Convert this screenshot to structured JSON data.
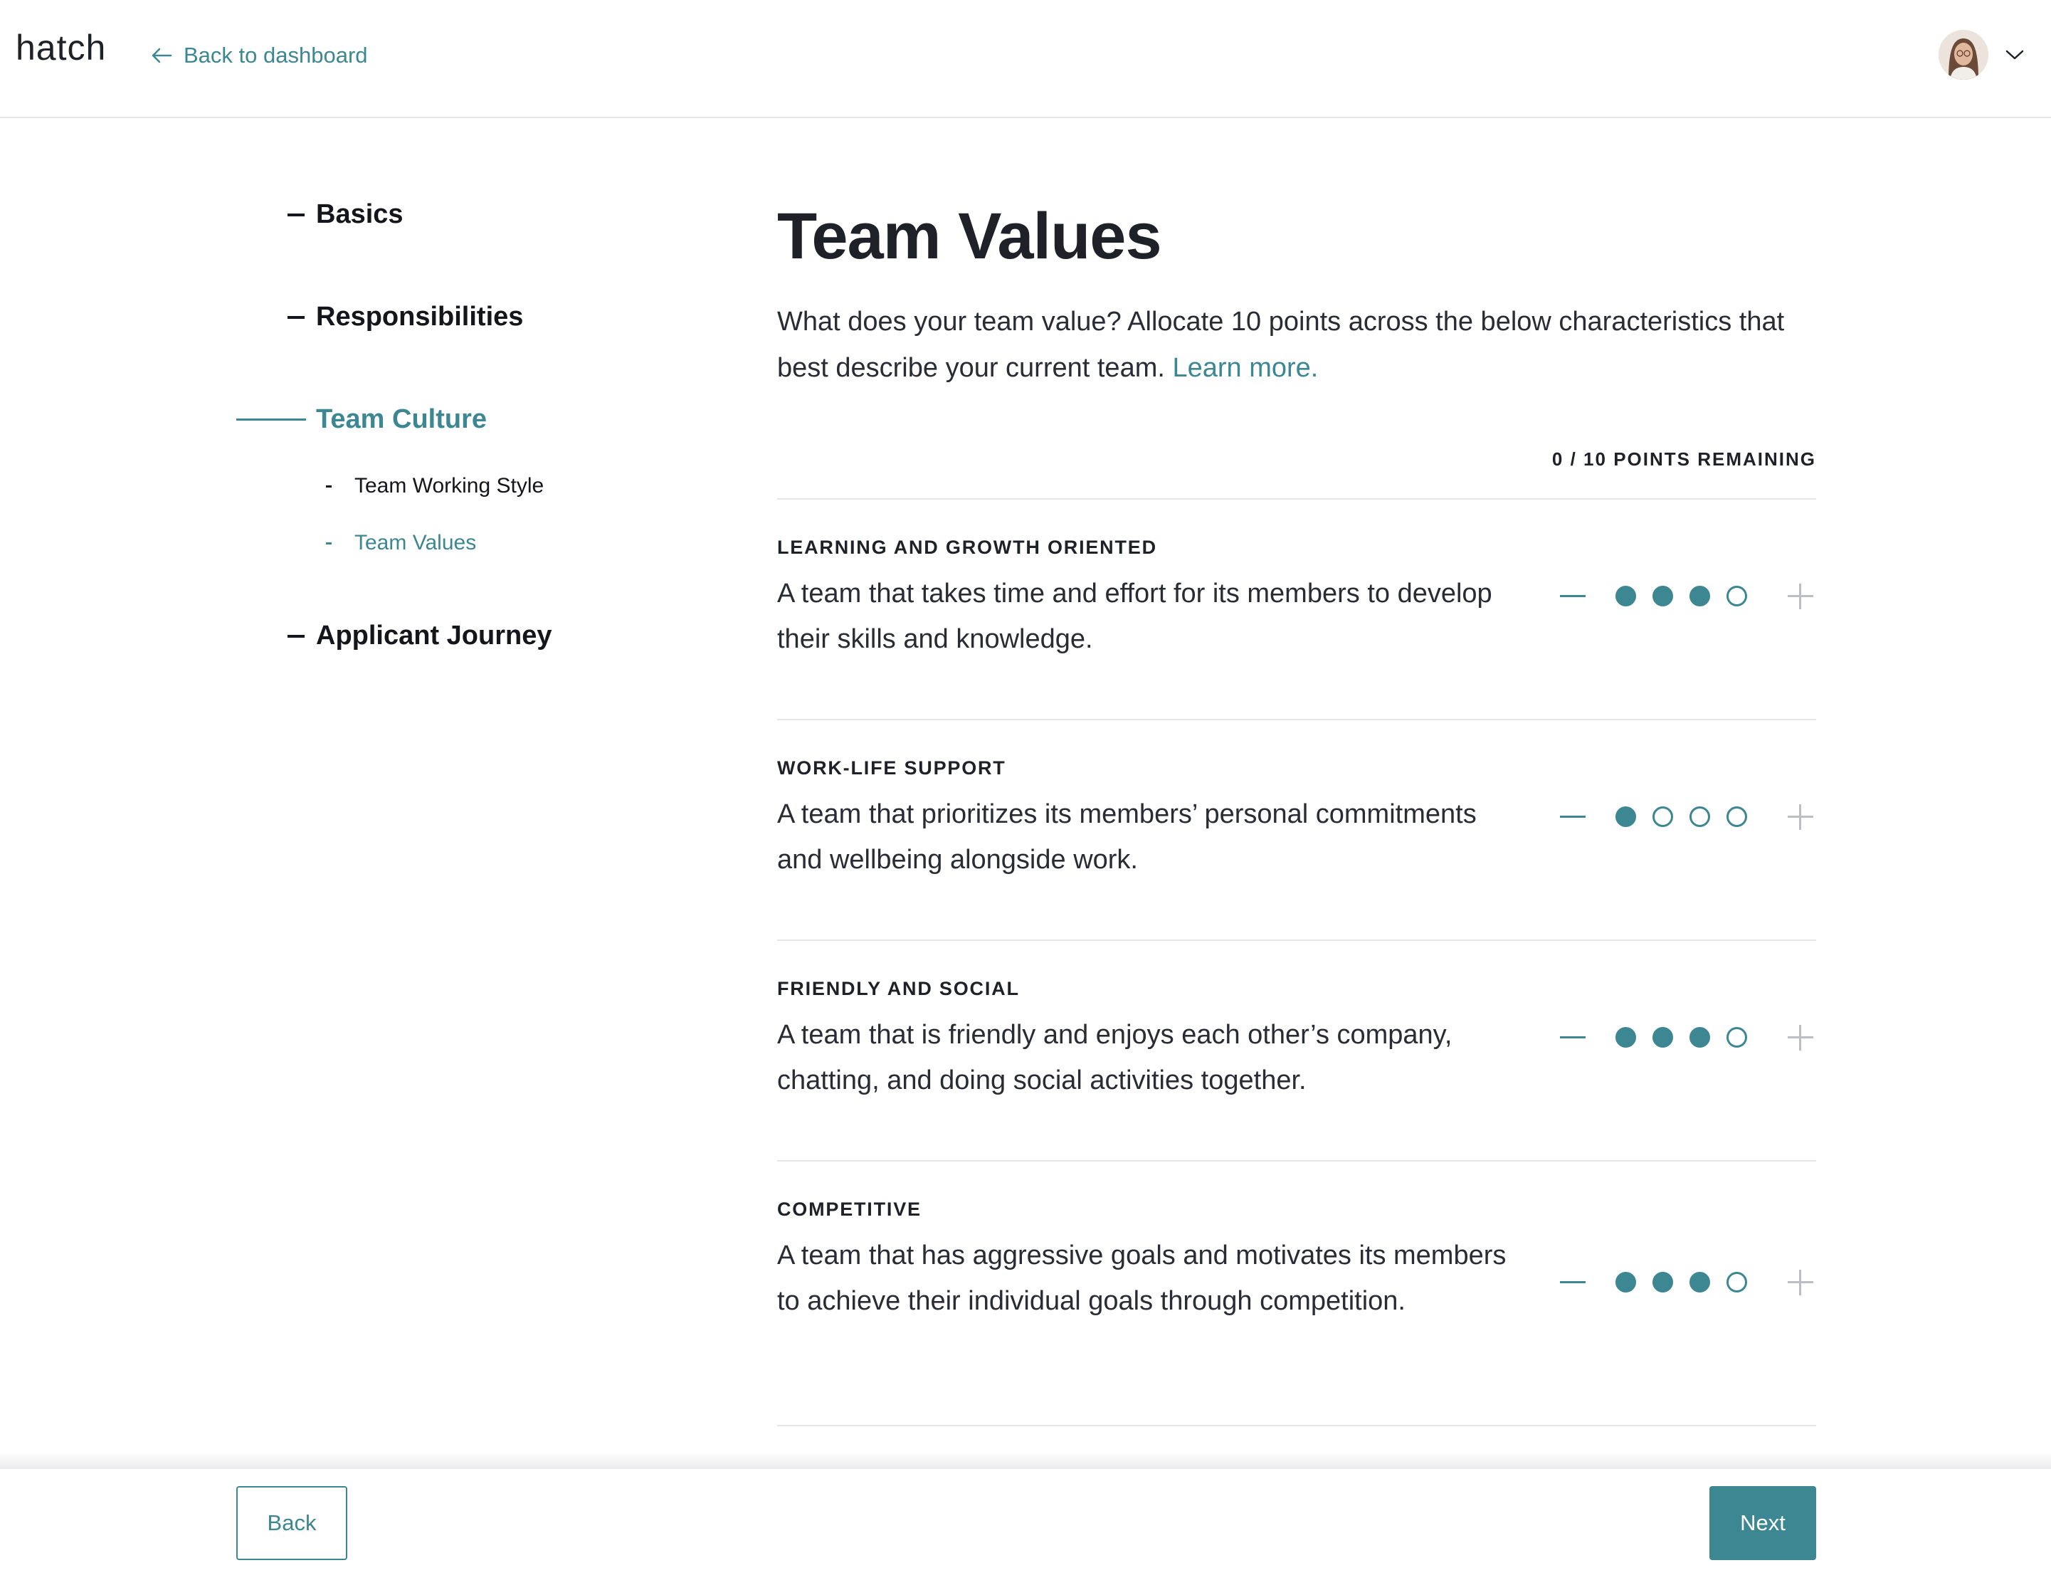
{
  "header": {
    "logo": "hatch",
    "back_link": "Back to dashboard",
    "icons": {
      "back": "arrow-left-icon",
      "user_menu": "chevron-down-icon"
    }
  },
  "sidebar": {
    "sections": [
      {
        "label": "Basics",
        "active": false
      },
      {
        "label": "Responsibilities",
        "active": false
      },
      {
        "label": "Team Culture",
        "active": true
      },
      {
        "label": "Applicant Journey",
        "active": false
      }
    ],
    "sub_items": [
      {
        "label": "Team Working Style",
        "active": false
      },
      {
        "label": "Team Values",
        "active": true
      }
    ]
  },
  "main": {
    "title": "Team Values",
    "intro": "What does your team value? Allocate 10 points across the below characteristics that best describe your current team.",
    "learn_more": "Learn more.",
    "points_remaining": "0 / 10 POINTS REMAINING",
    "values": [
      {
        "label": "LEARNING AND GROWTH ORIENTED",
        "description": "A team that takes time and effort for its members to develop their skills and knowledge.",
        "points": 3,
        "max": 4
      },
      {
        "label": "WORK-LIFE SUPPORT",
        "description": "A team that prioritizes its members’ personal commitments and wellbeing alongside work.",
        "points": 1,
        "max": 4
      },
      {
        "label": "FRIENDLY AND SOCIAL",
        "description": "A team that is friendly and enjoys each other’s company, chatting, and doing social activities together.",
        "points": 3,
        "max": 4
      },
      {
        "label": "COMPETITIVE",
        "description": "A team that has aggressive goals and motivates its members to achieve their individual goals through competition.",
        "points": 3,
        "max": 4
      }
    ]
  },
  "footer": {
    "back_label": "Back",
    "next_label": "Next"
  },
  "colors": {
    "accent": "#3c8791",
    "text": "#1f2129",
    "divider": "#e6e6e9"
  }
}
